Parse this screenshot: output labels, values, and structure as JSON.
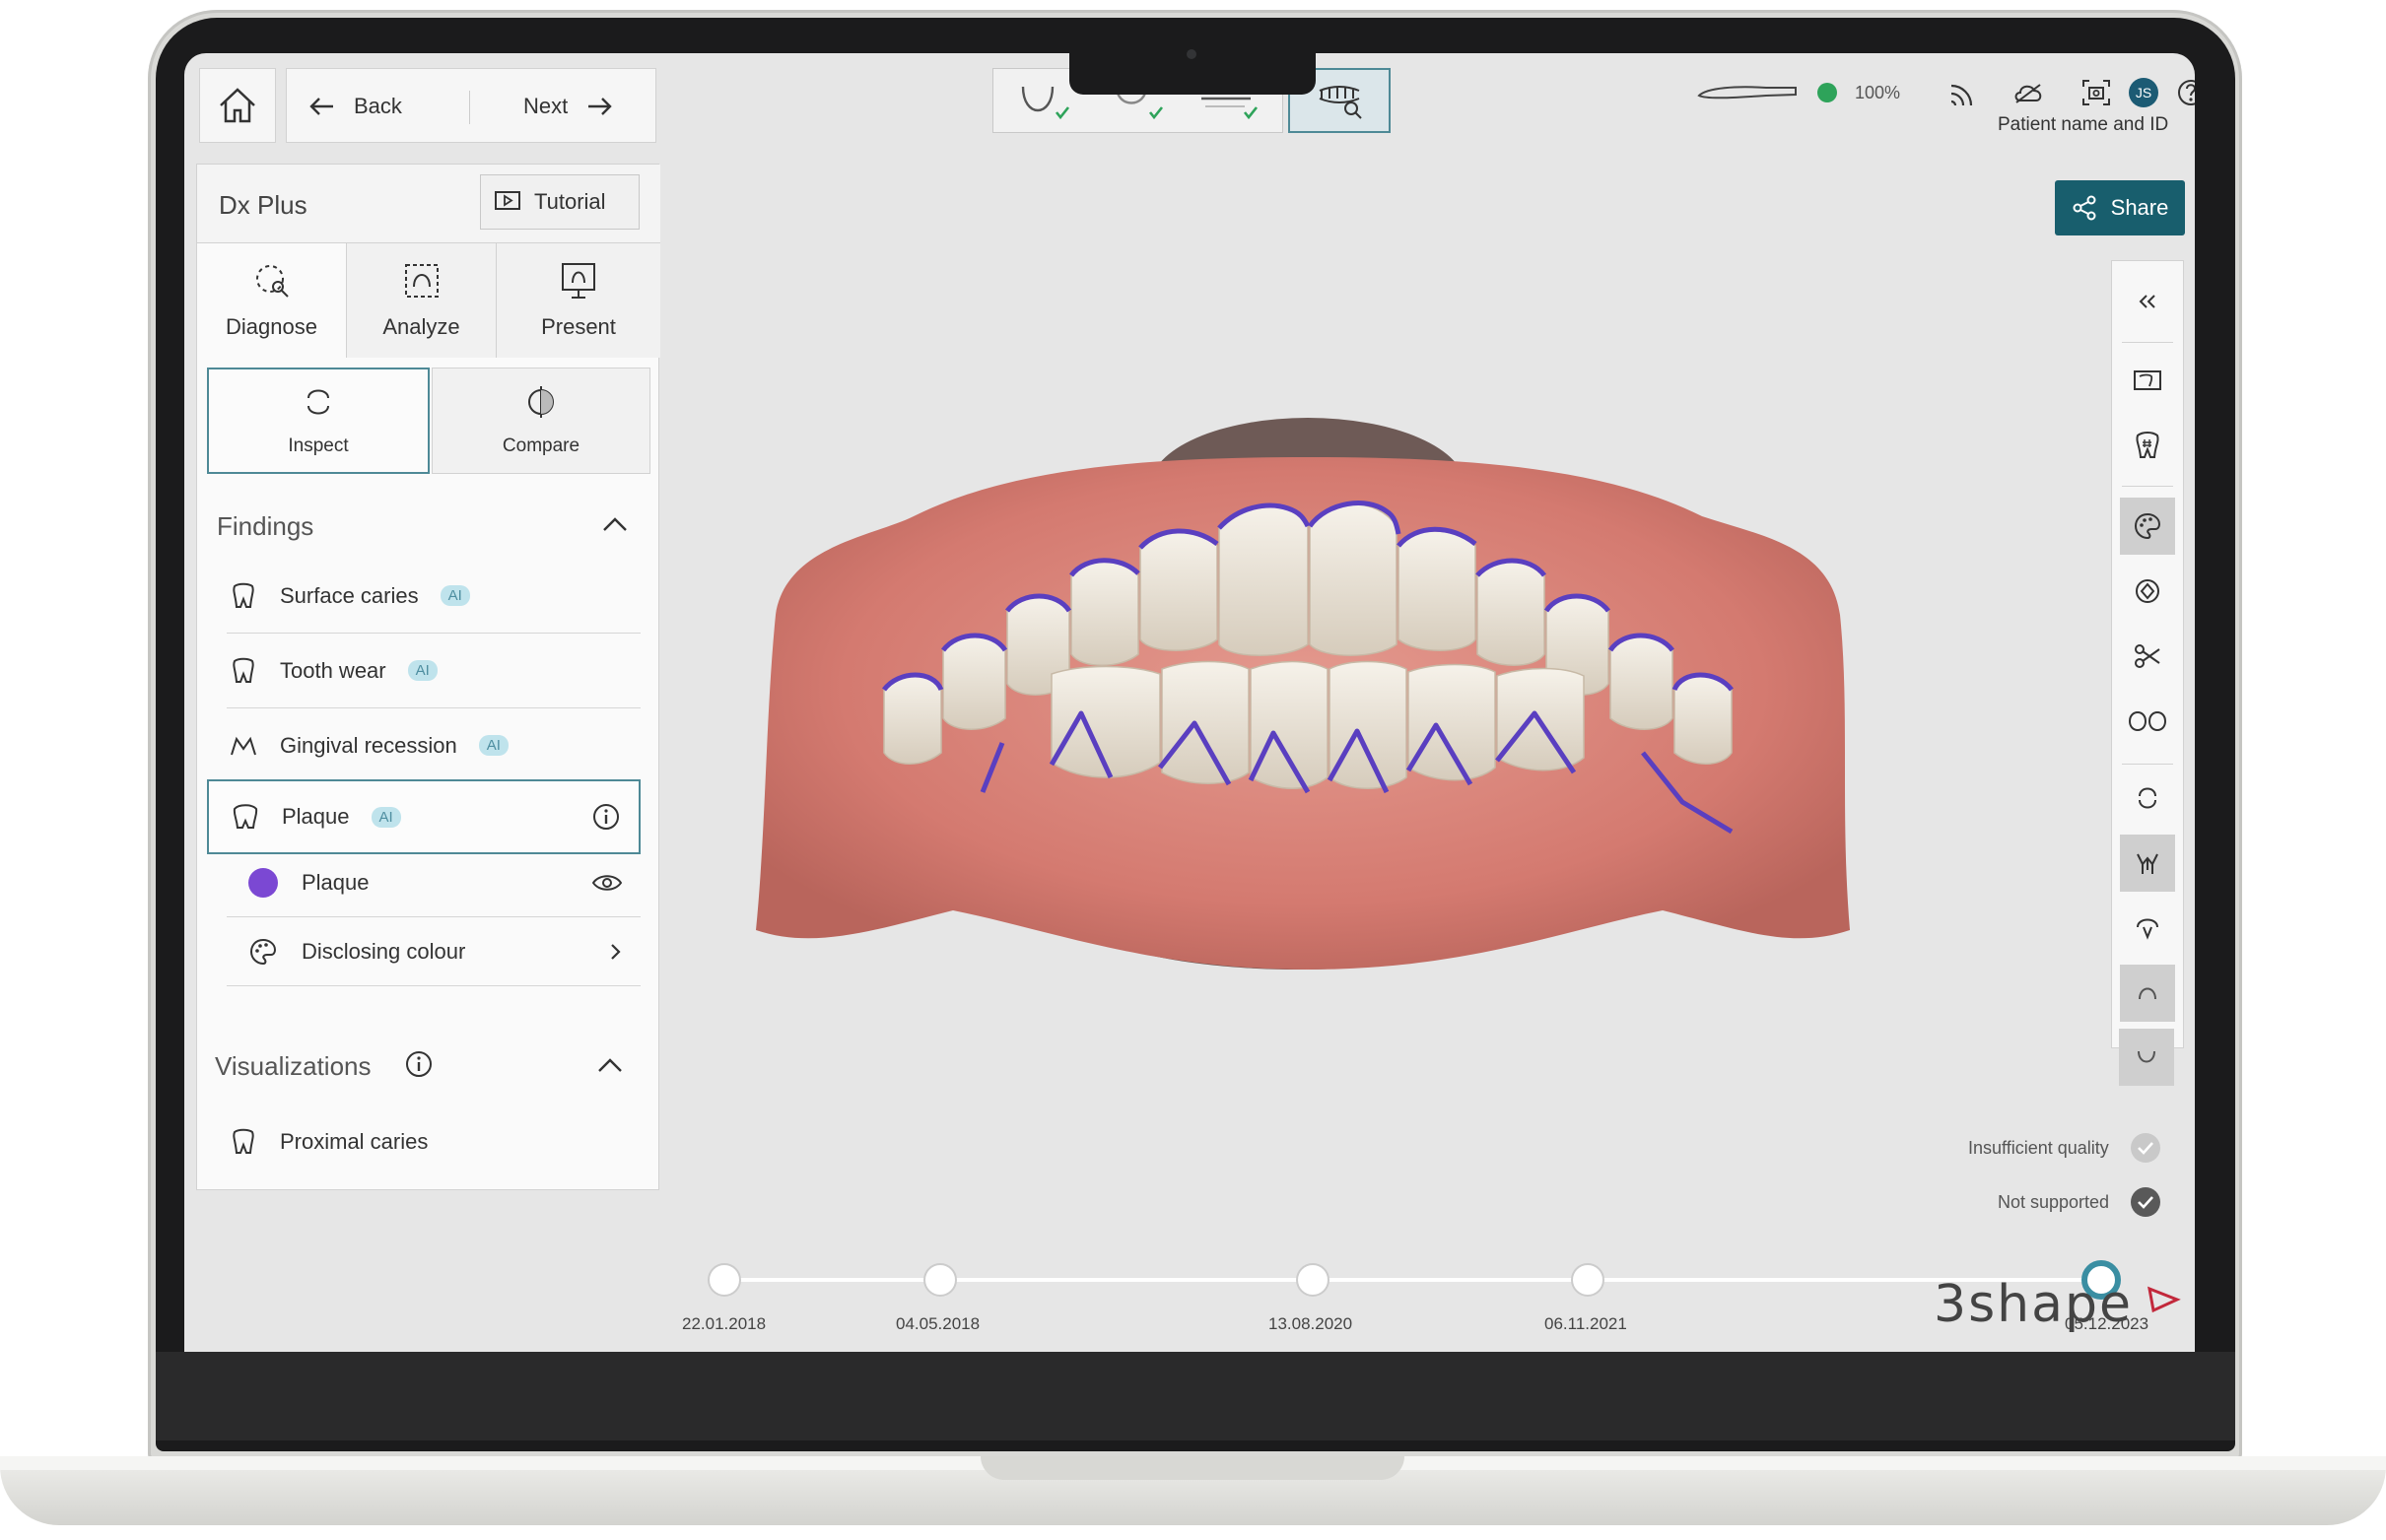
{
  "nav": {
    "back_label": "Back",
    "next_label": "Next"
  },
  "panel": {
    "title": "Dx Plus",
    "tutorial_label": "Tutorial",
    "modes": [
      {
        "label": "Diagnose",
        "icon": "diagnose-icon"
      },
      {
        "label": "Analyze",
        "icon": "analyze-icon"
      },
      {
        "label": "Present",
        "icon": "present-icon"
      }
    ],
    "subtabs": [
      {
        "label": "Inspect",
        "icon": "inspect-icon"
      },
      {
        "label": "Compare",
        "icon": "compare-icon"
      }
    ],
    "findings_title": "Findings",
    "findings": [
      {
        "label": "Surface caries",
        "badge": "AI",
        "icon": "tooth-icon"
      },
      {
        "label": "Tooth wear",
        "badge": "AI",
        "icon": "tooth-icon"
      },
      {
        "label": "Gingival recession",
        "badge": "AI",
        "icon": "gum-icon"
      },
      {
        "label": "Plaque",
        "badge": "AI",
        "icon": "molar-icon"
      }
    ],
    "plaque_children": [
      {
        "label": "Plaque",
        "color": "#7b48d3",
        "icon": "eye-icon"
      },
      {
        "label": "Disclosing colour",
        "icon": "palette-icon"
      }
    ],
    "visualizations_title": "Visualizations",
    "visualizations": [
      {
        "label": "Proximal caries",
        "icon": "tooth-icon"
      }
    ]
  },
  "header": {
    "battery": "100%",
    "status_color": "#2ea35a",
    "user_initials": "JS",
    "patient": "Patient name and ID",
    "share_label": "Share",
    "accent": "#185e6d"
  },
  "legend": {
    "insufficient": "Insufficient quality",
    "not_supported": "Not supported"
  },
  "timeline": {
    "dates": [
      "22.01.2018",
      "04.05.2018",
      "13.08.2020",
      "06.11.2021",
      "05.12.2023"
    ],
    "active_index": 4
  },
  "brand": {
    "name": "3shape"
  }
}
